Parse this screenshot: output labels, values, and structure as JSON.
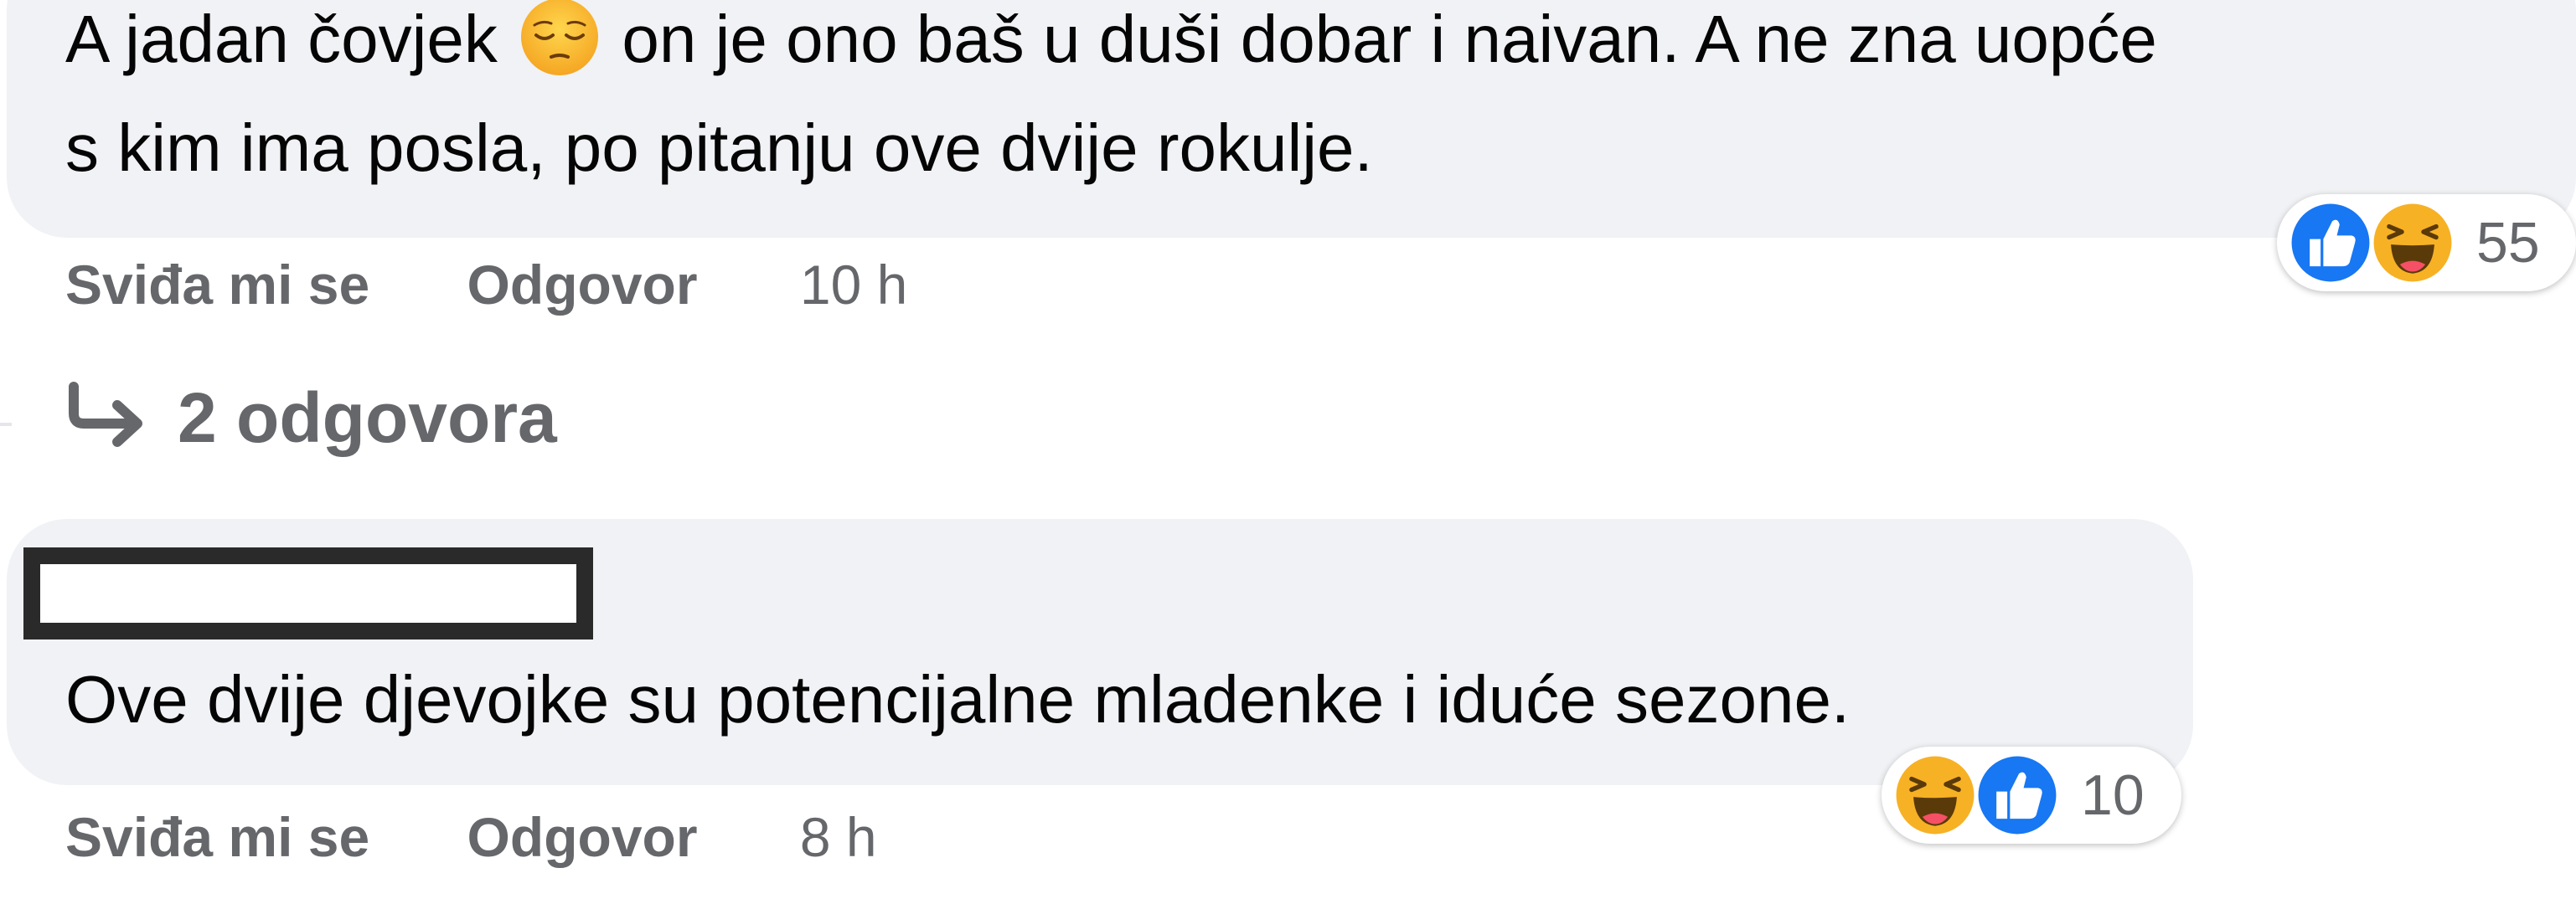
{
  "comments": [
    {
      "text_line1_before": "A jadan čovjek",
      "inline_emoji": "pensive-face-emoji",
      "text_line1_after": "on je ono baš u duši dobar i naivan. A ne zna uopće",
      "text_line2": "s kim ima posla, po pitanju ove dvije rokulje.",
      "like_label": "Sviđa mi se",
      "reply_label": "Odgovor",
      "time": "10 h",
      "replies_label": "2 odgovora",
      "reactions": {
        "icons": [
          "like-icon",
          "haha-icon"
        ],
        "count": "55"
      }
    },
    {
      "author_redacted": true,
      "text": "Ove dvije djevojke su potencijalne mladenke i iduće sezone.",
      "like_label": "Sviđa mi se",
      "reply_label": "Odgovor",
      "time": "8 h",
      "reactions": {
        "icons": [
          "haha-icon",
          "like-icon"
        ],
        "count": "10"
      }
    }
  ],
  "colors": {
    "bubble_bg": "#f0f2f5",
    "meta_text": "#65676b",
    "like_blue": "#1877f2",
    "haha_yellow": "#f7b125"
  }
}
